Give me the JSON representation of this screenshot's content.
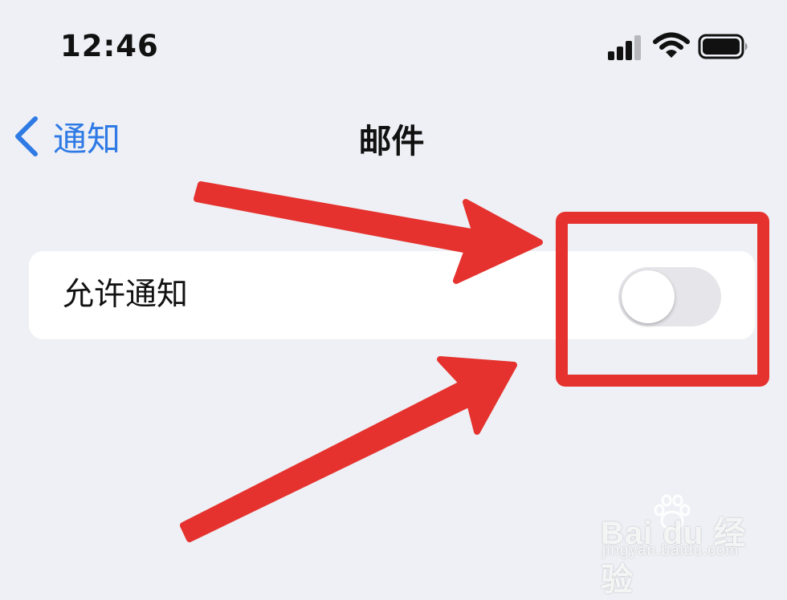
{
  "status_bar": {
    "time": "12:46",
    "icons": [
      "cellular-signal-icon",
      "wifi-icon",
      "battery-icon"
    ]
  },
  "nav": {
    "back_label": "通知",
    "title": "邮件"
  },
  "settings": {
    "allow_notifications_label": "允许通知",
    "allow_notifications_on": false
  },
  "annotation": {
    "color": "#e5322e"
  },
  "watermark": {
    "brand": "Bai du 经验",
    "url": "jingyan.baidu.com"
  },
  "colors": {
    "background": "#eef0f5",
    "accent": "#2f7ae5",
    "toggle_off": "#e6e6ea"
  }
}
